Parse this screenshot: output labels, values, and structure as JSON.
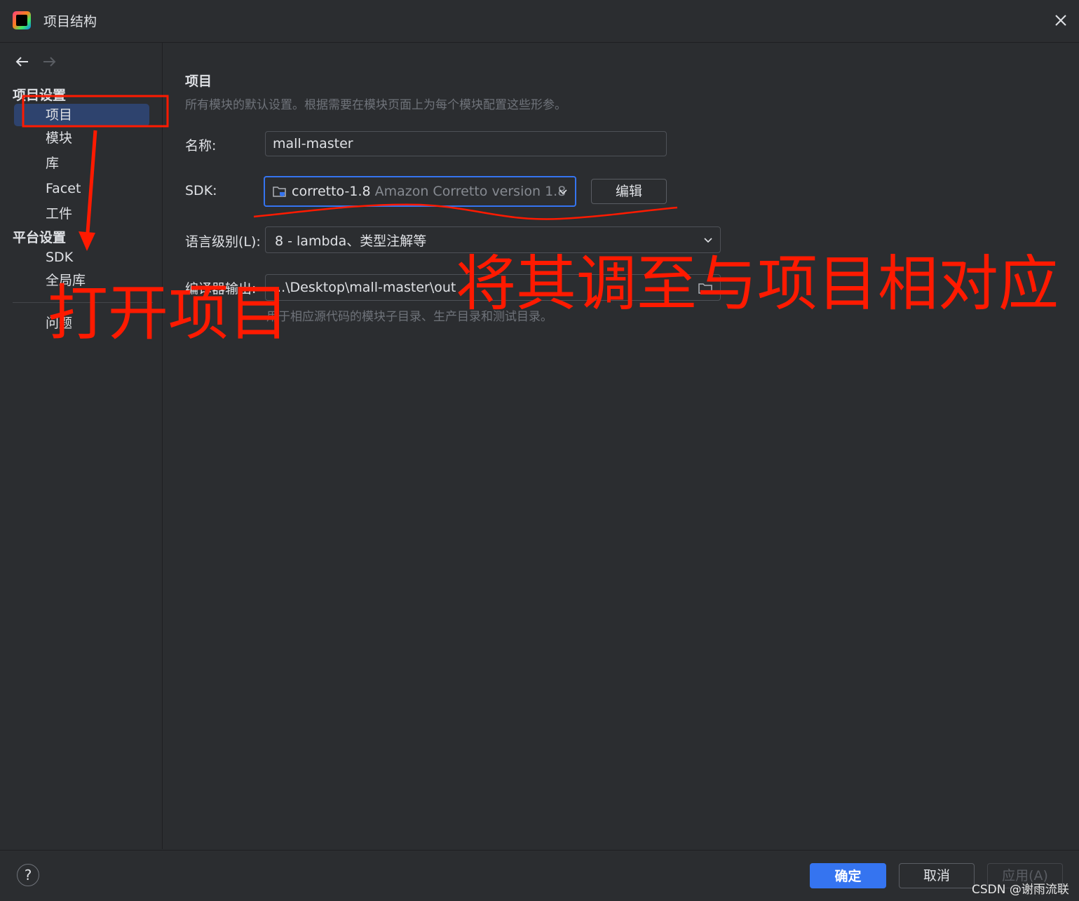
{
  "window": {
    "title": "项目结构"
  },
  "sidebar": {
    "section_project_settings": "项目设置",
    "items_project": [
      "项目",
      "模块",
      "库",
      "Facet",
      "工件"
    ],
    "section_platform_settings": "平台设置",
    "items_platform": [
      "SDK",
      "全局库"
    ],
    "problems": "问题"
  },
  "main": {
    "heading": "项目",
    "description": "所有模块的默认设置。根据需要在模块页面上为每个模块配置这些形参。",
    "name_label": "名称:",
    "name_value": "mall-master",
    "sdk_label": "SDK:",
    "sdk_value": "corretto-1.8",
    "sdk_detail": "Amazon Corretto version 1.8",
    "sdk_edit_button": "编辑",
    "language_level_label": "语言级别(L):",
    "language_level_value": "8 - lambda、类型注解等",
    "compiler_output_label": "编译器输出:",
    "compiler_output_value": "...\\Desktop\\mall-master\\out",
    "compiler_output_hint": "用于相应源代码的模块子目录、生产目录和测试目录。"
  },
  "footer": {
    "help": "?",
    "ok_button": "确定",
    "cancel_button": "取消",
    "apply_button": "应用(A)"
  },
  "annotations": {
    "open_project": "打开项目",
    "adjust_to_project": "将其调至与项目相对应"
  },
  "watermark": "CSDN @谢雨流联",
  "colors": {
    "background": "#2b2d30",
    "accent": "#3574f0",
    "selected_item": "#2e436e",
    "annotation_red": "#ff1a00"
  }
}
